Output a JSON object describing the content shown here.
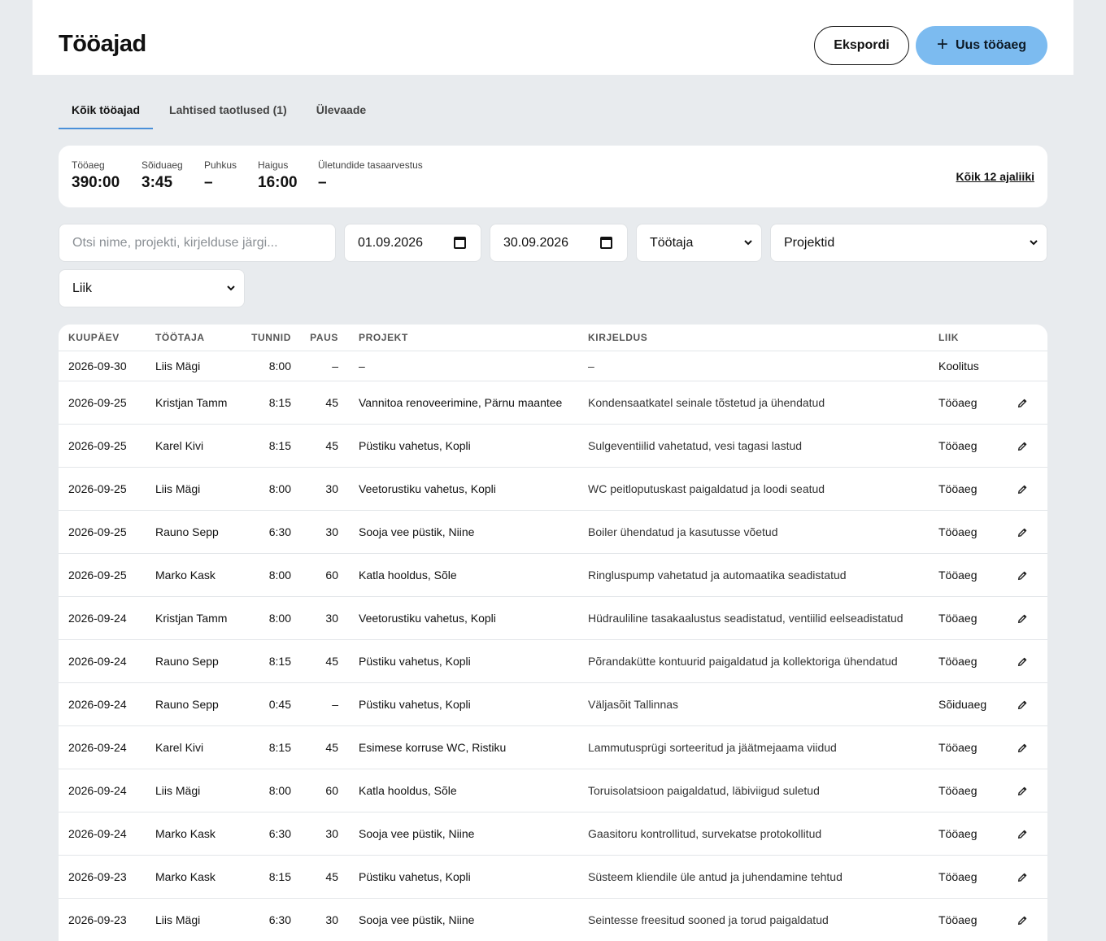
{
  "header": {
    "title": "Tööajad",
    "export_label": "Ekspordi",
    "new_icon": "plus-icon",
    "new_label": "Uus tööaeg"
  },
  "tabs": [
    {
      "label": "Kõik tööajad",
      "active": true
    },
    {
      "label": "Lahtised taotlused (1)",
      "active": false
    },
    {
      "label": "Ülevaade",
      "active": false
    }
  ],
  "summary": {
    "stats": [
      {
        "label": "Tööaeg",
        "value": "390:00"
      },
      {
        "label": "Sõiduaeg",
        "value": "3:45"
      },
      {
        "label": "Puhkus",
        "value": "–"
      },
      {
        "label": "Haigus",
        "value": "16:00"
      },
      {
        "label": "Ületundide tasaarvestus",
        "value": "–"
      }
    ],
    "all_types_link": "Kõik 12 ajaliiki"
  },
  "filters": {
    "search_placeholder": "Otsi nime, projekti, kirjelduse järgi...",
    "date_from": "01.09.2026",
    "date_to": "30.09.2026",
    "employee": "Töötaja",
    "projects": "Projektid",
    "type": "Liik"
  },
  "table": {
    "columns": [
      "KUUPÄEV",
      "TÖÖTAJA",
      "TUNNID",
      "PAUS",
      "PROJEKT",
      "KIRJELDUS",
      "LIIK"
    ],
    "rows": [
      {
        "date": "2026-09-30",
        "employee": "Liis Mägi",
        "hours": "8:00",
        "pause": "–",
        "project": "–",
        "description": "–",
        "type": "Koolitus",
        "editable": false
      },
      {
        "date": "2026-09-25",
        "employee": "Kristjan Tamm",
        "hours": "8:15",
        "pause": "45",
        "project": "Vannitoa renoveerimine, Pärnu maantee",
        "description": "Kondensaatkatel seinale tõstetud ja ühendatud",
        "type": "Tööaeg",
        "editable": true
      },
      {
        "date": "2026-09-25",
        "employee": "Karel Kivi",
        "hours": "8:15",
        "pause": "45",
        "project": "Püstiku vahetus, Kopli",
        "description": "Sulgeventiilid vahetatud, vesi tagasi lastud",
        "type": "Tööaeg",
        "editable": true
      },
      {
        "date": "2026-09-25",
        "employee": "Liis Mägi",
        "hours": "8:00",
        "pause": "30",
        "project": "Veetorustiku vahetus, Kopli",
        "description": "WC peitloputuskast paigaldatud ja loodi seatud",
        "type": "Tööaeg",
        "editable": true
      },
      {
        "date": "2026-09-25",
        "employee": "Rauno Sepp",
        "hours": "6:30",
        "pause": "30",
        "project": "Sooja vee püstik, Niine",
        "description": "Boiler ühendatud ja kasutusse võetud",
        "type": "Tööaeg",
        "editable": true
      },
      {
        "date": "2026-09-25",
        "employee": "Marko Kask",
        "hours": "8:00",
        "pause": "60",
        "project": "Katla hooldus, Sõle",
        "description": "Ringluspump vahetatud ja automaatika seadistatud",
        "type": "Tööaeg",
        "editable": true
      },
      {
        "date": "2026-09-24",
        "employee": "Kristjan Tamm",
        "hours": "8:00",
        "pause": "30",
        "project": "Veetorustiku vahetus, Kopli",
        "description": "Hüdrauliline tasakaalustus seadistatud, ventiilid eelseadistatud",
        "type": "Tööaeg",
        "editable": true
      },
      {
        "date": "2026-09-24",
        "employee": "Rauno Sepp",
        "hours": "8:15",
        "pause": "45",
        "project": "Püstiku vahetus, Kopli",
        "description": "Põrandakütte kontuurid paigaldatud ja kollektoriga ühendatud",
        "type": "Tööaeg",
        "editable": true
      },
      {
        "date": "2026-09-24",
        "employee": "Rauno Sepp",
        "hours": "0:45",
        "pause": "–",
        "project": "Püstiku vahetus, Kopli",
        "description": "Väljasõit Tallinnas",
        "type": "Sõiduaeg",
        "editable": true
      },
      {
        "date": "2026-09-24",
        "employee": "Karel Kivi",
        "hours": "8:15",
        "pause": "45",
        "project": "Esimese korruse WC, Ristiku",
        "description": "Lammutusprügi sorteeritud ja jäätmejaama viidud",
        "type": "Tööaeg",
        "editable": true
      },
      {
        "date": "2026-09-24",
        "employee": "Liis Mägi",
        "hours": "8:00",
        "pause": "60",
        "project": "Katla hooldus, Sõle",
        "description": "Toruisolatsioon paigaldatud, läbiviigud suletud",
        "type": "Tööaeg",
        "editable": true
      },
      {
        "date": "2026-09-24",
        "employee": "Marko Kask",
        "hours": "6:30",
        "pause": "30",
        "project": "Sooja vee püstik, Niine",
        "description": "Gaasitoru kontrollitud, survekatse protokollitud",
        "type": "Tööaeg",
        "editable": true
      },
      {
        "date": "2026-09-23",
        "employee": "Marko Kask",
        "hours": "8:15",
        "pause": "45",
        "project": "Püstiku vahetus, Kopli",
        "description": "Süsteem kliendile üle antud ja juhendamine tehtud",
        "type": "Tööaeg",
        "editable": true
      },
      {
        "date": "2026-09-23",
        "employee": "Liis Mägi",
        "hours": "6:30",
        "pause": "30",
        "project": "Sooja vee püstik, Niine",
        "description": "Seintesse freesitud sooned ja torud paigaldatud",
        "type": "Tööaeg",
        "editable": true
      }
    ]
  }
}
